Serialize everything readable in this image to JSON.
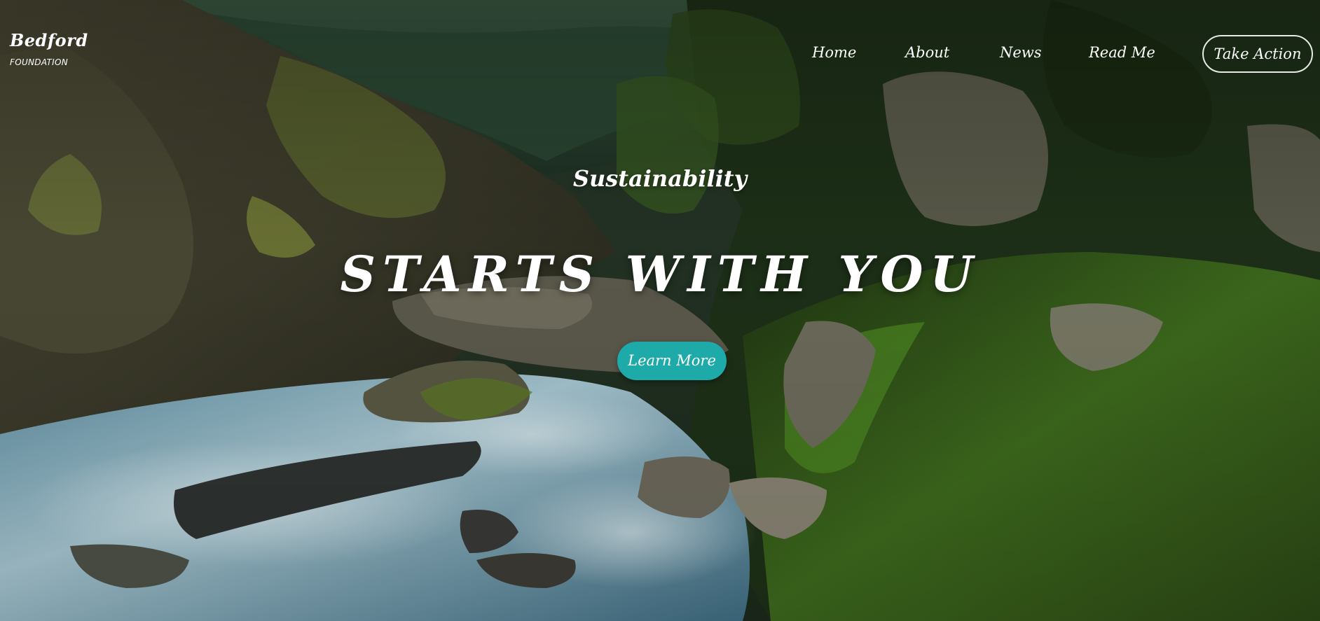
{
  "brand": {
    "name": "Bedford",
    "subtitle": "FOUNDATION"
  },
  "nav": {
    "links": [
      "Home",
      "About",
      "News",
      "Read Me"
    ],
    "cta": "Take Action"
  },
  "hero": {
    "kicker": "Sustainability",
    "headline": "STARTS WITH YOU",
    "button": "Learn More",
    "button_color": "#1eaaa9"
  }
}
